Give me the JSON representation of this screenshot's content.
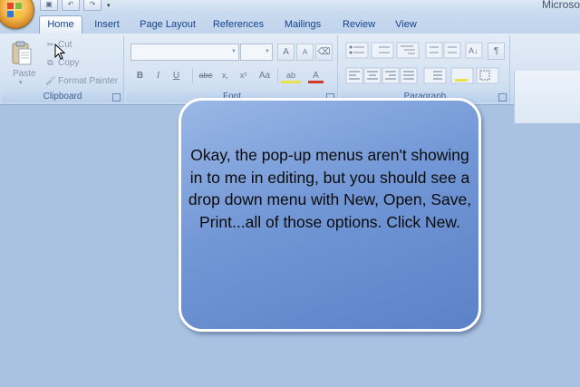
{
  "app": {
    "window_title": "Microso",
    "office_button_icon": "office-logo-icon"
  },
  "quick_access": {
    "items": [
      {
        "icon": "save-icon",
        "glyph": "▣"
      },
      {
        "icon": "undo-icon",
        "glyph": "↶"
      },
      {
        "icon": "redo-icon",
        "glyph": "↷"
      }
    ],
    "customize_arrow": "▾"
  },
  "tabs": [
    "Home",
    "Insert",
    "Page Layout",
    "References",
    "Mailings",
    "Review",
    "View"
  ],
  "active_tab": "Home",
  "clipboard": {
    "paste_label": "Paste",
    "paste_arrow": "▾",
    "cut_label": "Cut",
    "copy_label": "Copy",
    "format_painter_label": "Format Painter",
    "group_label": "Clipboard"
  },
  "font_group": {
    "font_name_value": "",
    "font_size_value": "",
    "grow_font": "A",
    "shrink_font": "A",
    "clear_format": "⌫",
    "bold": "B",
    "italic": "I",
    "underline": "U",
    "strikethrough": "abe",
    "subscript": "x,",
    "superscript": "x²",
    "change_case": "Aa",
    "highlight": "ab",
    "font_color": "A",
    "group_label": "Font"
  },
  "paragraph_group": {
    "group_label": "Paragraph",
    "show_marks": "¶"
  },
  "callout": {
    "text": "Okay, the pop-up menus aren't showing in to me in editing, but you should see a drop down menu with New, Open, Save, Print...all of those options. Click New."
  },
  "colors": {
    "ribbon_bg": "#d6e3f3",
    "tab_text": "#15428b",
    "callout_fill": "#6f93d4",
    "background": "#a9c2e2"
  }
}
